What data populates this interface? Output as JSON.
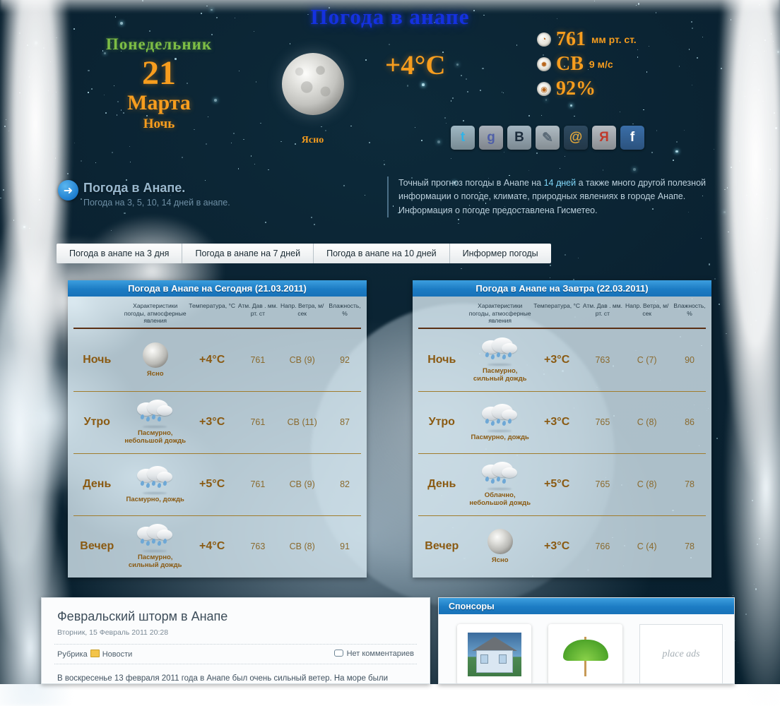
{
  "site": {
    "title": "Погода в анапе"
  },
  "hero": {
    "weekday": "Понедельник",
    "day_number": "21",
    "month": "Марта",
    "day_part": "Ночь",
    "condition": "Ясно",
    "temperature": "+4°C",
    "metrics": [
      {
        "icon": "pressure-gauge-icon",
        "glyph": "◔",
        "value": "761",
        "unit": "мм рт. ст."
      },
      {
        "icon": "wind-vane-icon",
        "glyph": "✹",
        "value": "СВ",
        "unit": "9 м/с"
      },
      {
        "icon": "humidity-drop-icon",
        "glyph": "◉",
        "value": "92%",
        "unit": ""
      }
    ],
    "social": [
      {
        "name": "twitter-icon",
        "glyph": "t",
        "bg": "#9fb8c4",
        "fg": "#2fb4e8"
      },
      {
        "name": "google-icon",
        "glyph": "g",
        "bg": "#a9b1bb",
        "fg": "#4f5fa8"
      },
      {
        "name": "vkontakte-icon",
        "glyph": "В",
        "bg": "#a4b6c2",
        "fg": "#1c2c3c"
      },
      {
        "name": "livejournal-icon",
        "glyph": "✎",
        "bg": "#b0bcc4",
        "fg": "#5a6a77"
      },
      {
        "name": "mailru-icon",
        "glyph": "@",
        "bg": "#2e4a60",
        "fg": "#e5a93a"
      },
      {
        "name": "yandex-icon",
        "glyph": "Я",
        "bg": "#b7bcc2",
        "fg": "#c0392b"
      },
      {
        "name": "facebook-icon",
        "glyph": "f",
        "bg": "#3a6ea8",
        "fg": "#ffffff"
      }
    ]
  },
  "intro": {
    "heading": "Погода в Анапе.",
    "subheading": "Погода на 3, 5, 10, 14 дней в анапе.",
    "blurb_pre": "Точный прогноз погоды в Анапе на ",
    "blurb_hl": "14 дней",
    "blurb_post": " а также много другой полезной информации о погоде, климате, природных явлениях в городе Анапе. Информация о погоде предоставлена Гисметео."
  },
  "tabs": [
    {
      "label": "Погода в анапе на 3 дня"
    },
    {
      "label": "Погода в анапе на 7 дней"
    },
    {
      "label": "Погода в анапе на 10 дней"
    },
    {
      "label": "Информер погоды"
    }
  ],
  "columns": {
    "period": "",
    "desc": "Характеристики погоды, атмосферные явления",
    "temp": "Температура, °С",
    "pressure": "Атм. Дав . мм. рт. ст",
    "wind": "Напр. Ветра, м/сек",
    "humidity": "Влажность, %"
  },
  "today": {
    "title": "Погода в Анапе на Сегодня (21.03.2011)",
    "rows": [
      {
        "period": "Ночь",
        "icon": "moon-clear-icon",
        "desc": "Ясно",
        "temp": "+4°C",
        "pressure": "761",
        "wind": "СВ (9)",
        "humidity": "92"
      },
      {
        "period": "Утро",
        "icon": "rain-cloud-icon",
        "desc": "Пасмурно, небольшой дождь",
        "temp": "+3°C",
        "pressure": "761",
        "wind": "СВ (11)",
        "humidity": "87"
      },
      {
        "period": "День",
        "icon": "rain-cloud-icon",
        "desc": "Пасмурно, дождь",
        "temp": "+5°C",
        "pressure": "761",
        "wind": "СВ (9)",
        "humidity": "82"
      },
      {
        "period": "Вечер",
        "icon": "rain-cloud-icon",
        "desc": "Пасмурно, сильный дождь",
        "temp": "+4°C",
        "pressure": "763",
        "wind": "СВ (8)",
        "humidity": "91"
      }
    ]
  },
  "tomorrow": {
    "title": "Погода в Анапе на Завтра (22.03.2011)",
    "rows": [
      {
        "period": "Ночь",
        "icon": "rain-cloud-icon",
        "desc": "Пасмурно, сильный дождь",
        "temp": "+3°C",
        "pressure": "763",
        "wind": "С (7)",
        "humidity": "90"
      },
      {
        "period": "Утро",
        "icon": "rain-cloud-icon",
        "desc": "Пасмурно, дождь",
        "temp": "+3°C",
        "pressure": "765",
        "wind": "С (8)",
        "humidity": "86"
      },
      {
        "period": "День",
        "icon": "rain-cloud-icon",
        "desc": "Облачно, небольшой дождь",
        "temp": "+5°C",
        "pressure": "765",
        "wind": "С (8)",
        "humidity": "78"
      },
      {
        "period": "Вечер",
        "icon": "moon-clear-icon",
        "desc": "Ясно",
        "temp": "+3°C",
        "pressure": "766",
        "wind": "С (4)",
        "humidity": "78"
      }
    ]
  },
  "article": {
    "title": "Февральский шторм в Анапе",
    "date": "Вторник, 15 Февраль 2011 20:28",
    "category_label": "Рубрика",
    "category": "Новости",
    "comments": "Нет комментариев",
    "body": "В воскресенье 13 февраля 2011 года в Анапе был очень сильный ветер. На море были"
  },
  "sponsors": {
    "title": "Спонсоры",
    "items": [
      {
        "name": "house-thumb"
      },
      {
        "name": "umbrella-thumb"
      }
    ],
    "ads_placeholder": "place ads"
  },
  "colors": {
    "accent_blue": "#1872b8",
    "title_blue": "#1431e0",
    "orange": "#f79d1e",
    "green": "#7dbd45",
    "brown": "#8a5a12"
  }
}
